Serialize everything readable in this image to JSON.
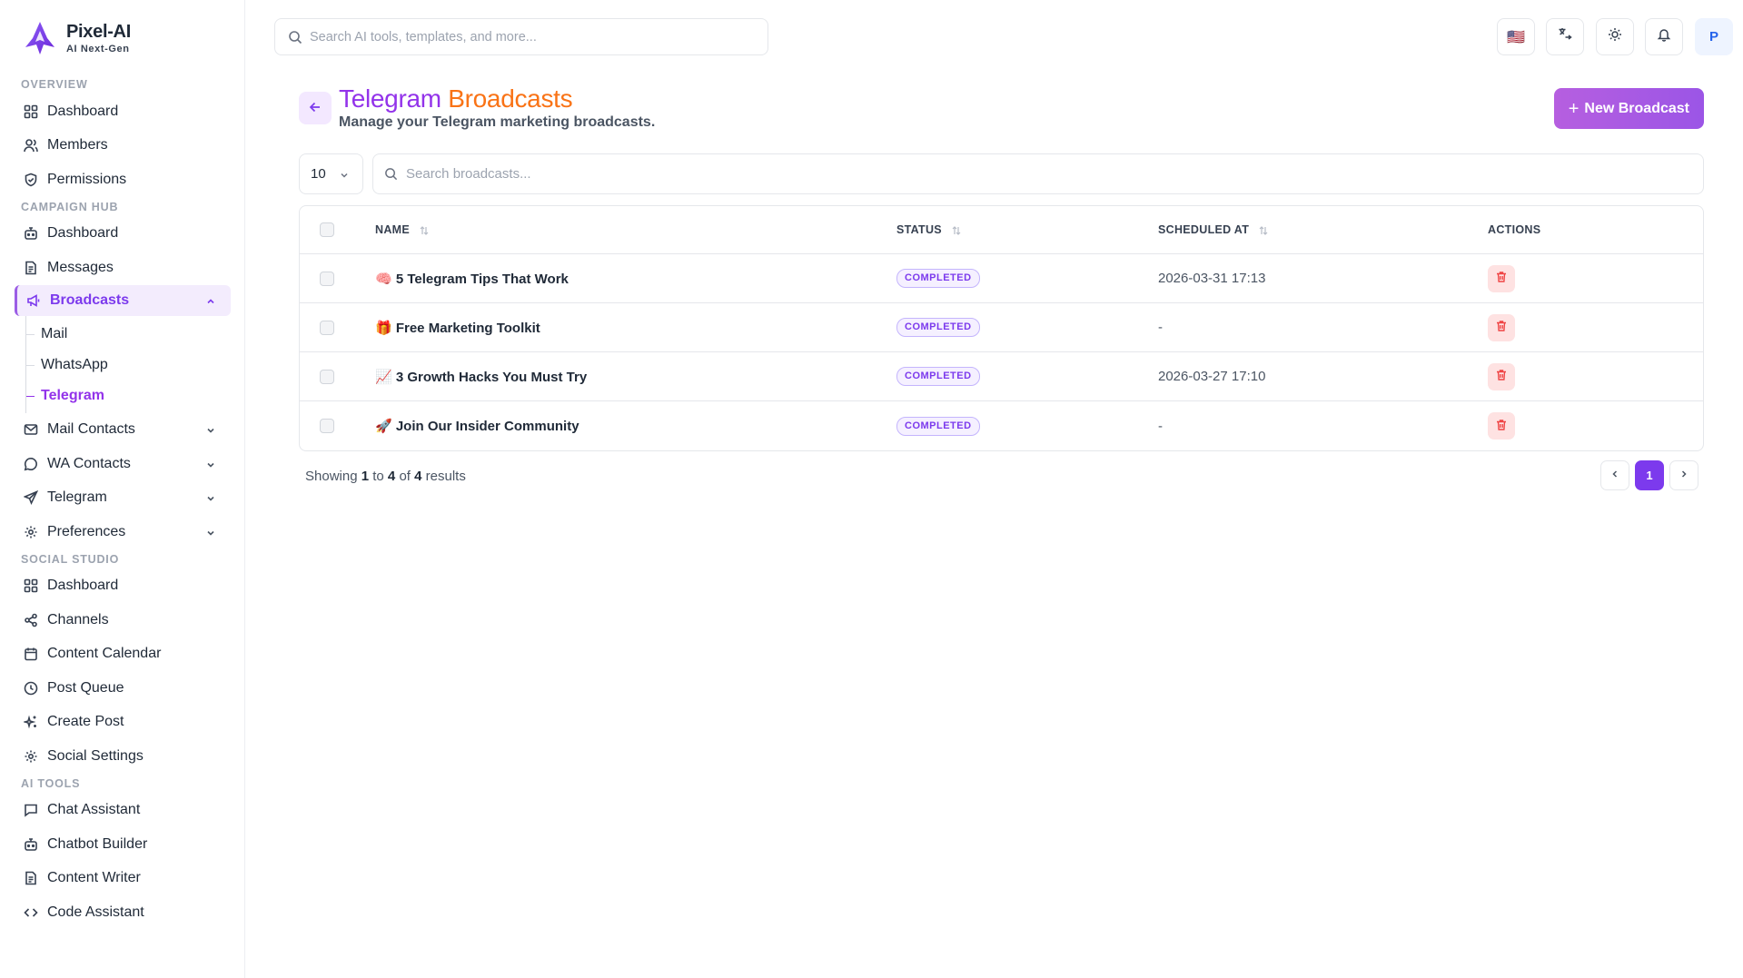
{
  "brand": {
    "name": "Pixel-AI",
    "tagline": "AI Next-Gen",
    "accent": "#7c3aed",
    "danger": "#ef4444"
  },
  "sidebar": {
    "sections": [
      {
        "label": "OVERVIEW",
        "items": [
          {
            "label": "Dashboard",
            "icon": "grid-icon"
          },
          {
            "label": "Members",
            "icon": "users-icon"
          },
          {
            "label": "Permissions",
            "icon": "shield-icon"
          }
        ]
      },
      {
        "label": "CAMPAIGN HUB",
        "items": [
          {
            "label": "Dashboard",
            "icon": "bot-icon"
          },
          {
            "label": "Messages",
            "icon": "file-text-icon"
          },
          {
            "label": "Broadcasts",
            "icon": "megaphone-icon",
            "expanded": true,
            "active": true,
            "children": [
              "Mail",
              "WhatsApp",
              "Telegram"
            ],
            "active_child": "Telegram"
          },
          {
            "label": "Mail Contacts",
            "icon": "mail-icon",
            "expandable": true
          },
          {
            "label": "WA Contacts",
            "icon": "chat-bubble-icon",
            "expandable": true
          },
          {
            "label": "Telegram",
            "icon": "send-icon",
            "expandable": true
          },
          {
            "label": "Preferences",
            "icon": "gear-icon",
            "expandable": true
          }
        ]
      },
      {
        "label": "SOCIAL STUDIO",
        "items": [
          {
            "label": "Dashboard",
            "icon": "grid-icon"
          },
          {
            "label": "Channels",
            "icon": "share-icon"
          },
          {
            "label": "Content Calendar",
            "icon": "calendar-icon"
          },
          {
            "label": "Post Queue",
            "icon": "clock-icon"
          },
          {
            "label": "Create Post",
            "icon": "sparkles-icon"
          },
          {
            "label": "Social Settings",
            "icon": "gear-icon"
          }
        ]
      },
      {
        "label": "AI TOOLS",
        "items": [
          {
            "label": "Chat Assistant",
            "icon": "message-square-icon"
          },
          {
            "label": "Chatbot Builder",
            "icon": "bot-icon"
          },
          {
            "label": "Content Writer",
            "icon": "file-text-icon"
          },
          {
            "label": "Code Assistant",
            "icon": "code-icon"
          }
        ]
      }
    ]
  },
  "header": {
    "search_placeholder": "Search AI tools, templates, and more...",
    "language_flag": "🇺🇸",
    "avatar_initial": "P"
  },
  "page": {
    "title_part1": "Telegram",
    "title_part2": "Broadcasts",
    "subtitle": "Manage your Telegram marketing broadcasts.",
    "new_button": "New Broadcast",
    "per_page": "10",
    "search_placeholder": "Search broadcasts..."
  },
  "table": {
    "columns": {
      "name": "NAME",
      "status": "STATUS",
      "scheduled": "SCHEDULED AT",
      "actions": "ACTIONS"
    },
    "rows": [
      {
        "name": "🧠 5 Telegram Tips That Work",
        "status": "COMPLETED",
        "scheduled_at": "2026-03-31 17:13"
      },
      {
        "name": "🎁 Free Marketing Toolkit",
        "status": "COMPLETED",
        "scheduled_at": "-"
      },
      {
        "name": "📈 3 Growth Hacks You Must Try",
        "status": "COMPLETED",
        "scheduled_at": "2026-03-27 17:10"
      },
      {
        "name": "🚀 Join Our Insider Community",
        "status": "COMPLETED",
        "scheduled_at": "-"
      }
    ]
  },
  "pagination": {
    "showing_prefix": "Showing",
    "from": "1",
    "to_word": "to",
    "to": "4",
    "of_word": "of",
    "total": "4",
    "results_word": "results",
    "current_page": "1"
  }
}
